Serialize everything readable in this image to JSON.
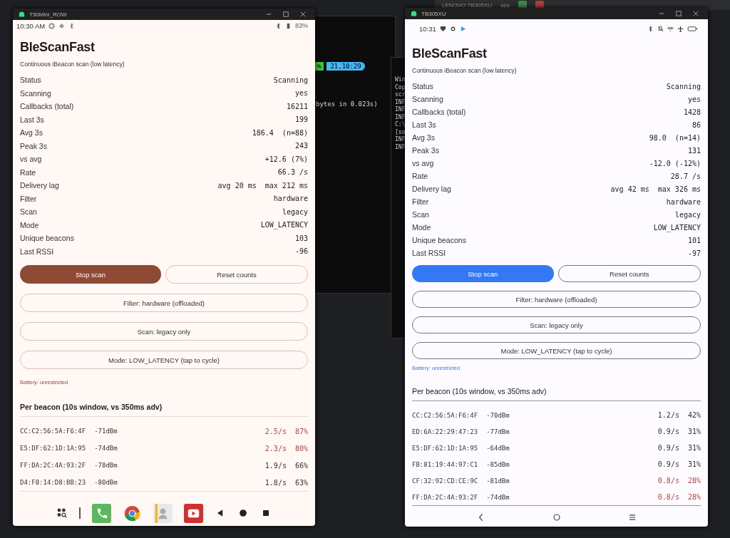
{
  "desktop": {
    "ide_bar": {
      "device": "LENOVO TB305XU",
      "config": "app"
    },
    "terminal": {
      "clock": "21,10:29",
      "battery_segment": "%",
      "line": "bytes in 0.023s)"
    },
    "console": {
      "lines": [
        "Win",
        "Cop",
        "scr",
        "INF",
        "INF",
        "INF",
        "C:\\",
        "[se",
        "INF",
        "INF"
      ]
    }
  },
  "devices": [
    {
      "kind": "phone",
      "window_title": "T50Mini_ROW",
      "status_bar": {
        "time": "10:30 AM",
        "battery": "83%"
      },
      "app": {
        "title": "BleScanFast",
        "subtitle": "Continuous iBeacon scan (low latency)",
        "stats": [
          {
            "label": "Status",
            "value": "Scanning"
          },
          {
            "label": "Scanning",
            "value": "yes"
          },
          {
            "label": "Callbacks (total)",
            "value": "16211"
          },
          {
            "label": "Last 3s",
            "value": "199"
          },
          {
            "label": "Avg 3s",
            "value": "186.4  (n=88)"
          },
          {
            "label": "Peak 3s",
            "value": "243"
          },
          {
            "label": "vs avg",
            "value": "+12.6 (7%)"
          },
          {
            "label": "Rate",
            "value": "66.3 /s"
          },
          {
            "label": "Delivery lag",
            "value": "avg 20 ms  max 212 ms"
          },
          {
            "label": "Filter",
            "value": "hardware"
          },
          {
            "label": "Scan",
            "value": "legacy"
          },
          {
            "label": "Mode",
            "value": "LOW_LATENCY"
          },
          {
            "label": "Unique beacons",
            "value": "103"
          },
          {
            "label": "Last RSSI",
            "value": "-96"
          }
        ],
        "primary_button": "Stop scan",
        "secondary_button": "Reset counts",
        "option_buttons": [
          "Filter: hardware (offloaded)",
          "Scan: legacy only",
          "Mode: LOW_LATENCY (tap to cycle)"
        ],
        "battery_note": "Battery: unrestricted",
        "section_title": "Per beacon (10s window, vs 350ms adv)",
        "beacons": [
          {
            "mac": "CC:C2:56:5A:F6:4F",
            "rssi": "-71dBm",
            "rate": "2.5/s",
            "share": "87%",
            "flagged": true
          },
          {
            "mac": "E5:DF:62:1D:1A:95",
            "rssi": "-74dBm",
            "rate": "2.3/s",
            "share": "80%",
            "flagged": true
          },
          {
            "mac": "FF:DA:2C:4A:93:2F",
            "rssi": "-78dBm",
            "rate": "1.9/s",
            "share": "66%",
            "flagged": false
          },
          {
            "mac": "D4:F0:14:D8:BB:23",
            "rssi": "-80dBm",
            "rate": "1.8/s",
            "share": "63%",
            "flagged": false
          }
        ]
      }
    },
    {
      "kind": "tablet",
      "window_title": "TB305XU",
      "status_bar": {
        "time": "10:31"
      },
      "app": {
        "title": "BleScanFast",
        "subtitle": "Continuous iBeacon scan (low latency)",
        "stats": [
          {
            "label": "Status",
            "value": "Scanning"
          },
          {
            "label": "Scanning",
            "value": "yes"
          },
          {
            "label": "Callbacks (total)",
            "value": "1428"
          },
          {
            "label": "Last 3s",
            "value": "86"
          },
          {
            "label": "Avg 3s",
            "value": "98.0  (n=14)"
          },
          {
            "label": "Peak 3s",
            "value": "131"
          },
          {
            "label": "vs avg",
            "value": "-12.0 (-12%)"
          },
          {
            "label": "Rate",
            "value": "28.7 /s"
          },
          {
            "label": "Delivery lag",
            "value": "avg 42 ms  max 326 ms"
          },
          {
            "label": "Filter",
            "value": "hardware"
          },
          {
            "label": "Scan",
            "value": "legacy"
          },
          {
            "label": "Mode",
            "value": "LOW_LATENCY"
          },
          {
            "label": "Unique beacons",
            "value": "101"
          },
          {
            "label": "Last RSSI",
            "value": "-97"
          }
        ],
        "primary_button": "Stop scan",
        "secondary_button": "Reset counts",
        "option_buttons": [
          "Filter: hardware (offloaded)",
          "Scan: legacy only",
          "Mode: LOW_LATENCY (tap to cycle)"
        ],
        "battery_note": "Battery: unrestricted",
        "section_title": "Per beacon (10s window, vs 350ms adv)",
        "beacons": [
          {
            "mac": "CC:C2:56:5A:F6:4F",
            "rssi": "-70dBm",
            "rate": "1.2/s",
            "share": "42%",
            "flagged": false
          },
          {
            "mac": "ED:6A:22:29:47:23",
            "rssi": "-77dBm",
            "rate": "0.9/s",
            "share": "31%",
            "flagged": false
          },
          {
            "mac": "E5:DF:62:1D:1A:95",
            "rssi": "-64dBm",
            "rate": "0.9/s",
            "share": "31%",
            "flagged": false
          },
          {
            "mac": "FB:81:19:44:97:C1",
            "rssi": "-85dBm",
            "rate": "0.9/s",
            "share": "31%",
            "flagged": false
          },
          {
            "mac": "CF:32:92:CD:CE:9C",
            "rssi": "-81dBm",
            "rate": "0.8/s",
            "share": "28%",
            "flagged": true
          },
          {
            "mac": "FF:DA:2C:4A:93:2F",
            "rssi": "-74dBm",
            "rate": "0.8/s",
            "share": "28%",
            "flagged": true
          }
        ]
      }
    }
  ]
}
